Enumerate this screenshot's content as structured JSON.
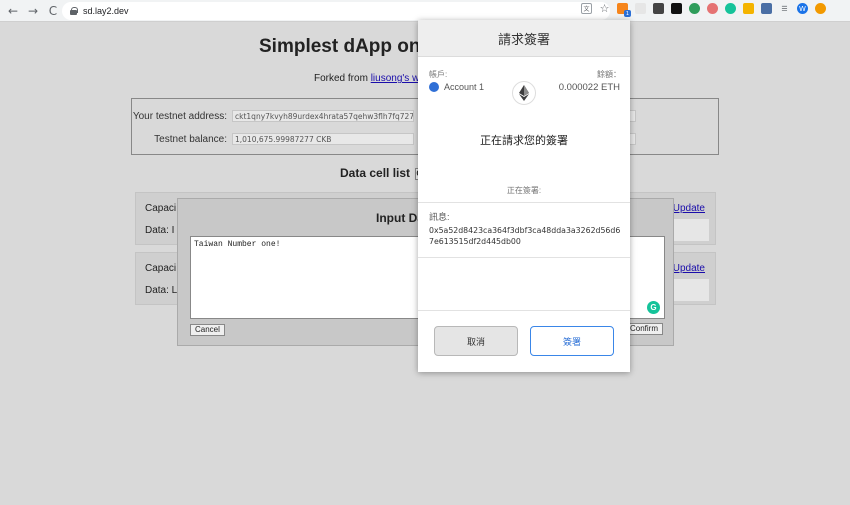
{
  "browser": {
    "url": "sd.lay2.dev",
    "nav": {
      "back": "←",
      "forward": "→",
      "reload": "C"
    },
    "badge": "1",
    "profile_initial": "W"
  },
  "page": {
    "title": "Simplest dApp on",
    "forked_prefix": "Forked from ",
    "forked_link": "liusong's w",
    "address_label": "Your testnet address:",
    "address_value": "ckt1qny7kvyh89urdex4hrata57qehw3flh7fq727guv5",
    "balance_label": "Testnet balance:",
    "balance_value": "1,010,675.99987277 CKB",
    "cell_list_title": "Data cell list",
    "cell_list_btn": "Cr",
    "cells": [
      {
        "capacity_label": "Capaci",
        "data_label": "Data: I l",
        "update": "Update"
      },
      {
        "capacity_label": "Capaci",
        "data_label": "Data: Lo",
        "update": "Update"
      }
    ]
  },
  "input_modal": {
    "title": "Input Da",
    "text": "Taiwan Number one!",
    "cancel": "Cancel",
    "confirm": "Confirm"
  },
  "metamask": {
    "header": "請求簽署",
    "account_label": "帳戶:",
    "balance_label": "餘額：",
    "account_name": "Account 1",
    "balance_value": "0.000022 ETH",
    "request_text": "正在請求您的簽署",
    "signing_text": "正在簽署:",
    "message_label": "訊息:",
    "message_value": "0x5a52d8423ca364f3dbf3ca48dda3a3262d56d67e613515df2d445db00",
    "cancel_button": "取消",
    "sign_button": "簽署"
  },
  "colors": {
    "page_bg": "#d9d9d9",
    "link": "#1a0dab",
    "metamask_sign": "#2a6fd6"
  }
}
